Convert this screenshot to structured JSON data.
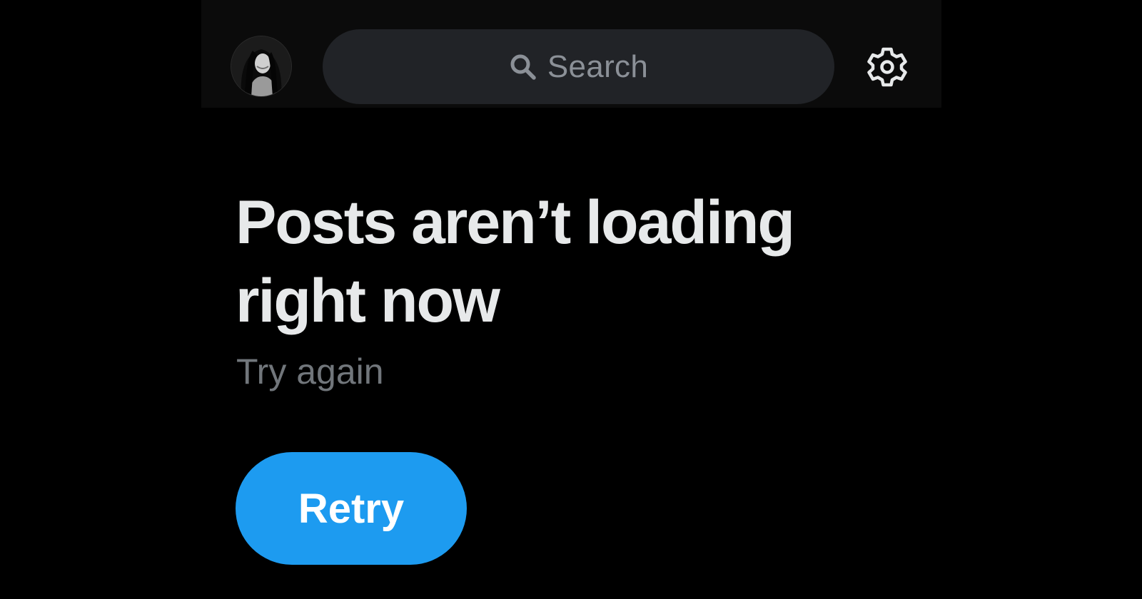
{
  "header": {
    "avatar_icon": "profile-photo",
    "search": {
      "placeholder": "Search",
      "icon": "search-icon"
    },
    "settings_icon": "gear-icon"
  },
  "main": {
    "headline": "Posts aren’t loading right now",
    "subtext": "Try again",
    "retry_label": "Retry"
  },
  "colors": {
    "background": "#000000",
    "top_bar": "#0b0b0b",
    "search_field": "#212327",
    "placeholder_text": "#8b9097",
    "headline_text": "#e7e9ea",
    "secondary_text": "#71767b",
    "accent": "#1d9bf0"
  }
}
